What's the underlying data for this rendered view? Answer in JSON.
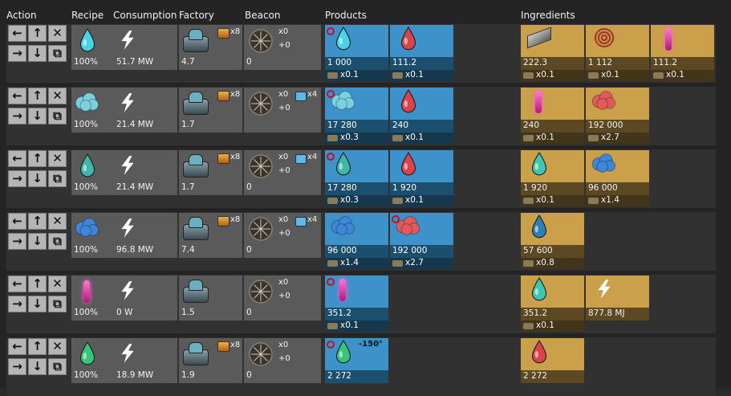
{
  "headers": {
    "action": "Action",
    "recipe": "Recipe",
    "consumption": "Consumption",
    "factory": "Factory",
    "beacon": "Beacon",
    "products": "Products",
    "ingredients": "Ingredients"
  },
  "rows": [
    {
      "pct": "100%",
      "consumption": "51.7 MW",
      "factory_count": "4.7",
      "factory_mod": "x8",
      "beacon_count": "0",
      "beacon_x": "x0",
      "beacon_plus": "+0",
      "beacon_mod": "",
      "products": [
        {
          "amount": "1 000",
          "sub": "x0.1",
          "icon": "fuel-drop-blue-icon",
          "color": "#4ad2e6",
          "flag": true,
          "sub_icon": "productivity-module-icon"
        },
        {
          "amount": "111.2",
          "sub": "x0.1",
          "icon": "fuel-drop-red-icon",
          "color": "#d9434b",
          "flag": false,
          "sub_icon": "transport-icon"
        }
      ],
      "ingredients": [
        {
          "amount": "222.3",
          "sub": "x0.1",
          "icon": "steel-beam-icon",
          "color": "#7a7a7a",
          "sub_icon": "productivity-module-icon"
        },
        {
          "amount": "1 112",
          "sub": "x0.1",
          "icon": "copper-coil-icon",
          "color": "#d07a4a",
          "sub_icon": "productivity-module-icon"
        },
        {
          "amount": "111.2",
          "sub": "x0.1",
          "icon": "plasma-pink-icon",
          "color": "#e84eb8",
          "sub_icon": "transport-icon"
        }
      ]
    },
    {
      "pct": "100%",
      "consumption": "21.4 MW",
      "factory_count": "1.7",
      "factory_mod": "x8",
      "beacon_count": "",
      "beacon_x": "x0",
      "beacon_plus": "+0",
      "beacon_mod": "x4",
      "products": [
        {
          "amount": "17 280",
          "sub": "x0.3",
          "icon": "fuel-drop-cloud-icon",
          "color": "#7ad0e0",
          "flag": true,
          "sub_icon": "transport-icon"
        },
        {
          "amount": "240",
          "sub": "x0.1",
          "icon": "fuel-drop-red-icon",
          "color": "#d9434b",
          "flag": false,
          "sub_icon": "transport-icon"
        }
      ],
      "ingredients": [
        {
          "amount": "240",
          "sub": "x0.1",
          "icon": "plasma-pink-icon",
          "color": "#e84eb8",
          "sub_icon": "transport-icon"
        },
        {
          "amount": "192 000",
          "sub": "x2.7",
          "icon": "red-cloud-icon",
          "color": "#e25a5a",
          "sub_icon": "transport-icon"
        }
      ]
    },
    {
      "pct": "100%",
      "consumption": "21.4 MW",
      "factory_count": "1.7",
      "factory_mod": "x8",
      "beacon_count": "0",
      "beacon_x": "x0",
      "beacon_plus": "+0",
      "beacon_mod": "x4",
      "products": [
        {
          "amount": "17 280",
          "sub": "x0.3",
          "icon": "fuel-drop-teal-icon",
          "color": "#3fb6a7",
          "flag": true,
          "sub_icon": "transport-icon"
        },
        {
          "amount": "1 920",
          "sub": "x0.1",
          "icon": "fuel-drop-red-icon",
          "color": "#d9434b",
          "flag": false,
          "sub_icon": "transport-icon"
        }
      ],
      "ingredients": [
        {
          "amount": "1 920",
          "sub": "x0.1",
          "icon": "fuel-drop-teal-icon",
          "color": "#3fc6b0",
          "sub_icon": "transport-icon"
        },
        {
          "amount": "96 000",
          "sub": "x1.4",
          "icon": "blue-cloud-icon",
          "color": "#3f86d8",
          "sub_icon": "transport-icon"
        }
      ]
    },
    {
      "pct": "100%",
      "consumption": "96.8 MW",
      "factory_count": "7.4",
      "factory_mod": "x8",
      "beacon_count": "0",
      "beacon_x": "x0",
      "beacon_plus": "+0",
      "beacon_mod": "x4",
      "products": [
        {
          "amount": "96 000",
          "sub": "x1.4",
          "icon": "blue-cloud-icon",
          "color": "#3f86d8",
          "flag": false,
          "sub_icon": "transport-icon"
        },
        {
          "amount": "192 000",
          "sub": "x2.7",
          "icon": "red-cloud-icon",
          "color": "#e25a5a",
          "flag": true,
          "sub_icon": "transport-icon"
        }
      ],
      "ingredients": [
        {
          "amount": "57 600",
          "sub": "x0.8",
          "icon": "fuel-drop-dark-blue-icon",
          "color": "#2f7fb5",
          "sub_icon": "transport-icon"
        }
      ]
    },
    {
      "pct": "100%",
      "consumption": "0 W",
      "factory_count": "1.5",
      "factory_mod": "",
      "beacon_count": "0",
      "beacon_x": "x0",
      "beacon_plus": "+0",
      "beacon_mod": "",
      "products": [
        {
          "amount": "351.2",
          "sub": "x0.1",
          "icon": "plasma-pink-icon",
          "color": "#e84eb8",
          "flag": true,
          "sub_icon": "transport-icon"
        }
      ],
      "ingredients": [
        {
          "amount": "351.2",
          "sub": "x0.1",
          "icon": "fuel-drop-teal-icon",
          "color": "#3fc6b0",
          "sub_icon": "transport-icon"
        },
        {
          "amount": "877.8 MJ",
          "sub": "",
          "icon": "lightning-icon",
          "color": "#ffffff",
          "sub_icon": ""
        }
      ]
    },
    {
      "pct": "100%",
      "consumption": "18.9 MW",
      "factory_count": "1.9",
      "factory_mod": "x8",
      "beacon_count": "0",
      "beacon_x": "x0",
      "beacon_plus": "+0",
      "beacon_mod": "",
      "products": [
        {
          "amount": "2 272",
          "sub": "",
          "icon": "fuel-drop-green-icon",
          "color": "#38c47a",
          "flag": true,
          "sub_icon": "",
          "temp": "-150°"
        }
      ],
      "ingredients": [
        {
          "amount": "2 272",
          "sub": "",
          "icon": "fuel-drop-red-icon",
          "color": "#d9434b",
          "sub_icon": ""
        }
      ]
    }
  ]
}
